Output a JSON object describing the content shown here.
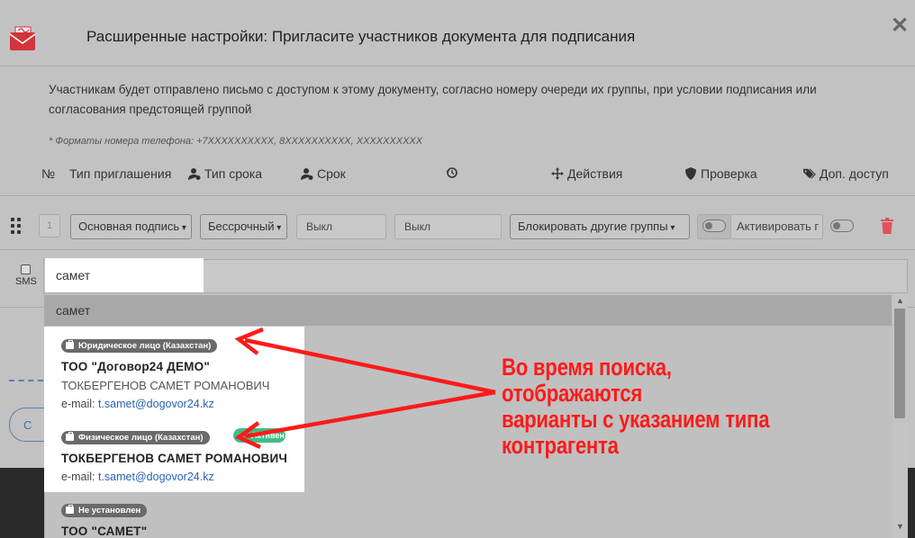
{
  "modal": {
    "title": "Расширенные настройки: Пригласите участников документа для подписания",
    "intro": "Участникам будет отправлено письмо с доступом к этому документу, согласно номеру очереди их группы, при условии подписания или согласования предстоящей группой",
    "phone_note": "* Форматы номера телефона: +7XXXXXXXXXX, 8XXXXXXXXXX, XXXXXXXXXX"
  },
  "columns": {
    "num": "№",
    "invite_type": "Тип приглашения",
    "term_type": "Тип срока",
    "term": "Срок",
    "actions": "Действия",
    "check": "Проверка",
    "extra_access": "Доп. доступ"
  },
  "row": {
    "number": "1",
    "signature_select": "Основная подпись",
    "term_select": "Бессрочный",
    "off_1": "Выкл",
    "off_2": "Выкл",
    "block_select": "Блокировать другие группы",
    "activate_text": "Активировать г"
  },
  "sms": {
    "label": "SMS",
    "search_value": "самет"
  },
  "dropdown": {
    "query": "самет",
    "items": [
      {
        "badge": "Юридическое лицо (Казахстан)",
        "name": "ТОО \"Договор24 ДЕМО\"",
        "person": "ТОКБЕРГЕНОВ САМЕТ РОМАНОВИЧ",
        "email_prefix": "e-mail: ",
        "email": "t.samet@dogovor24.kz"
      },
      {
        "badge": "Физическое лицо (Казахстан)",
        "extra_badge": "Активен",
        "name": "ТОКБЕРГЕНОВ САМЕТ РОМАНОВИЧ",
        "email_prefix": "e-mail: ",
        "email": "t.samet@dogovor24.kz"
      },
      {
        "badge": "Не установлен",
        "name": "ТОО \"САМЕТ\""
      }
    ]
  },
  "left_button": {
    "label": "С"
  },
  "annotation": {
    "line1": "Во время поиска, отображаются",
    "line2": "варианты с указанием типа",
    "line3": "контрагента"
  },
  "colors": {
    "overlay": "#c2c2c2",
    "annotation": "#ff1a1a",
    "link": "#2a62b0",
    "badge": "#6a6a6a",
    "active_badge": "#3fbf84",
    "trash": "#e0505a"
  }
}
